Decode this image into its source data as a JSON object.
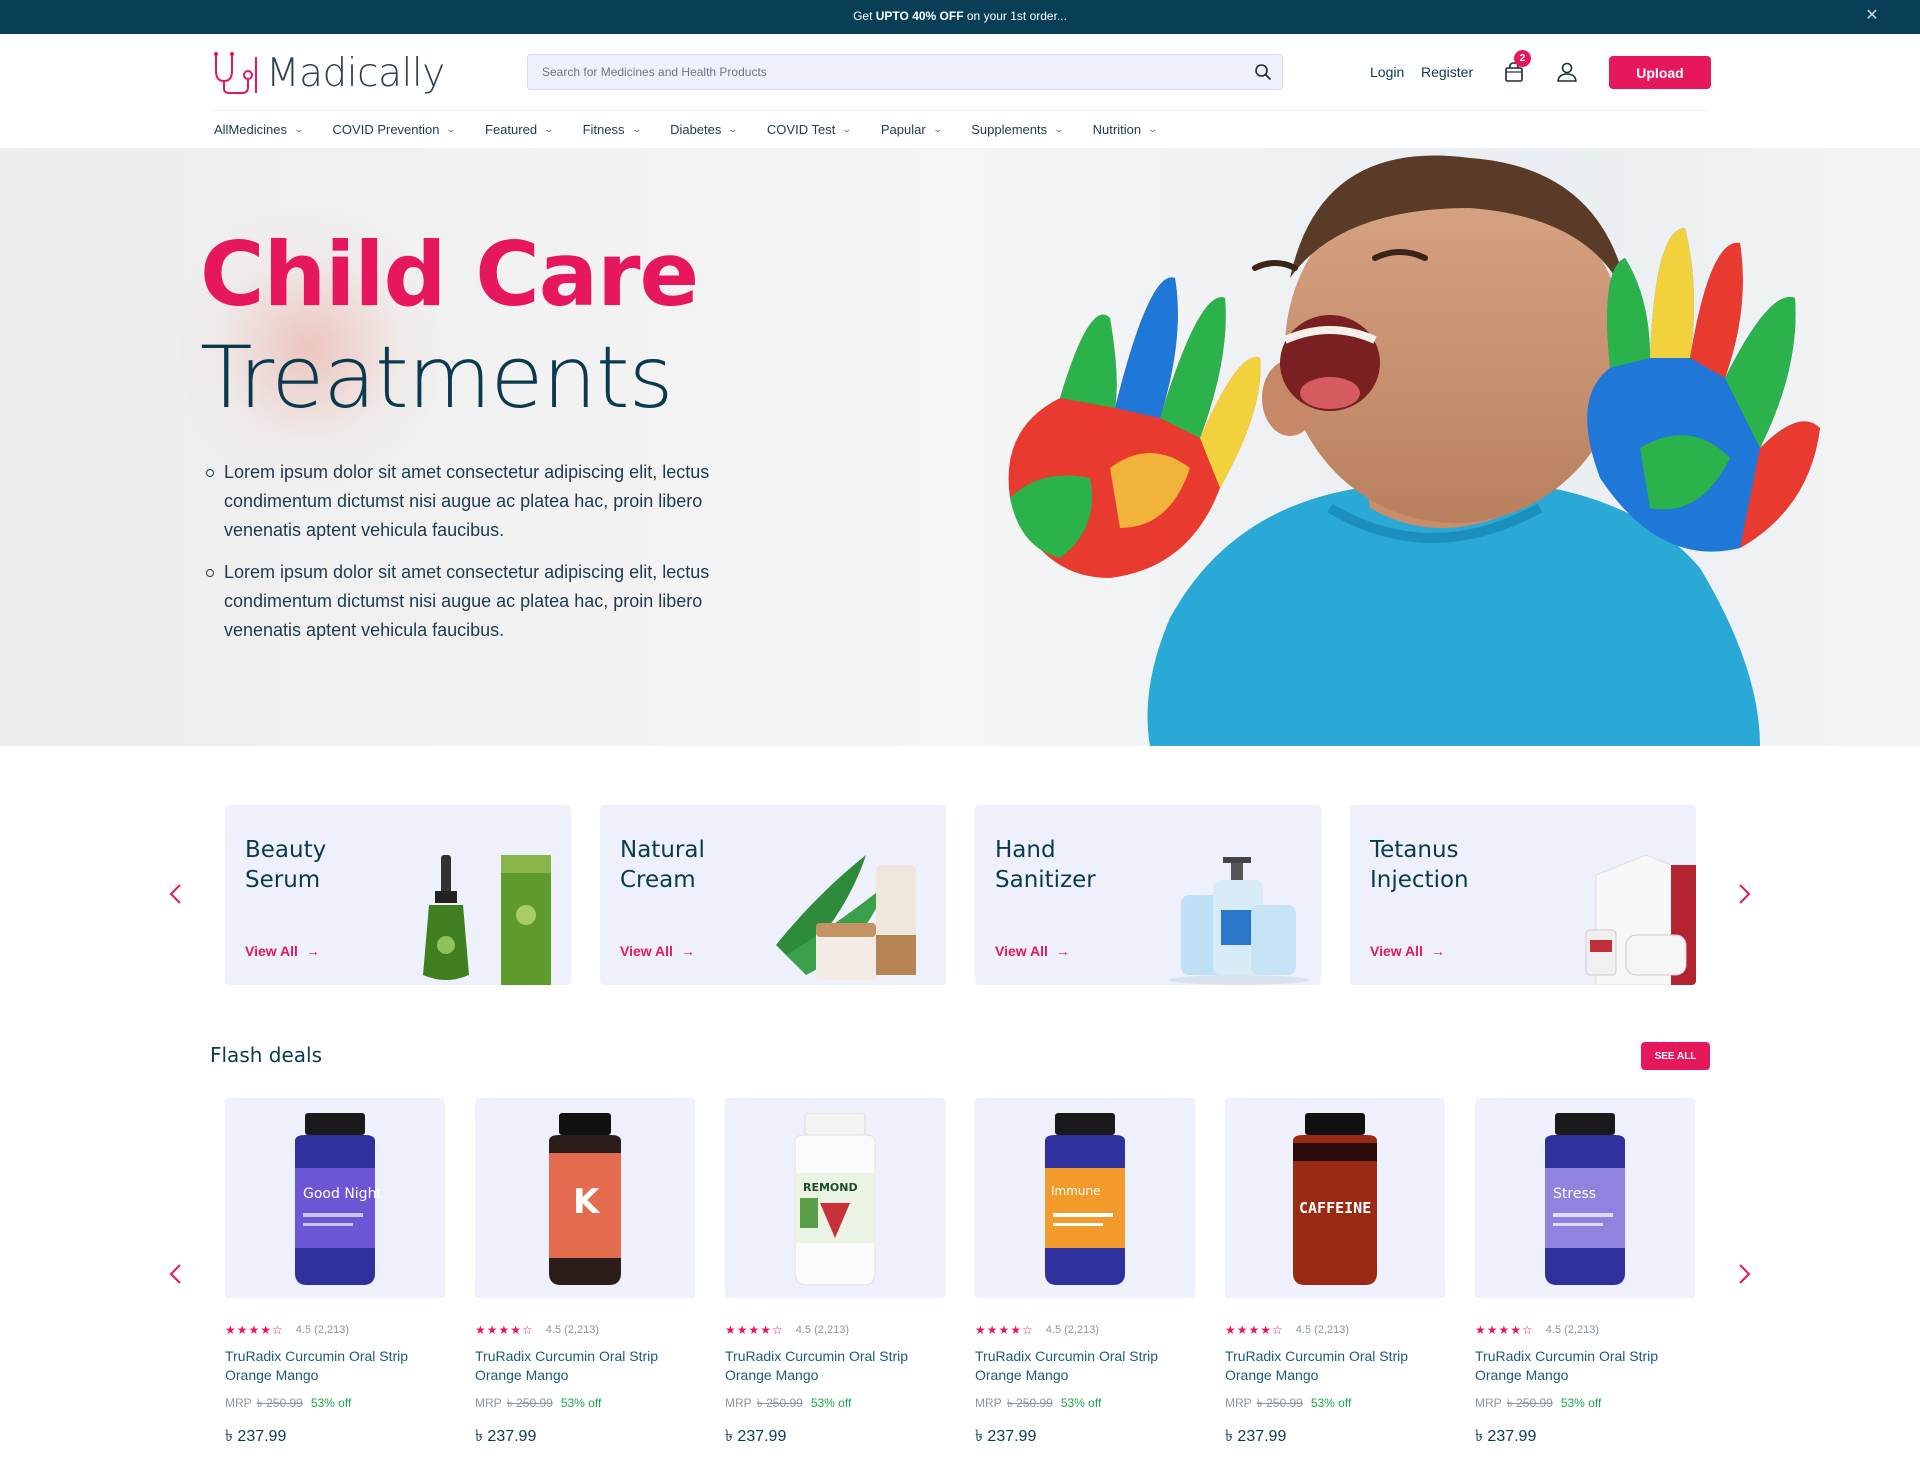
{
  "promo": {
    "prefix": "Get ",
    "highlight": "UPTO 40% OFF",
    "suffix": " on your 1st order..."
  },
  "brand": {
    "name": "Madically"
  },
  "search": {
    "placeholder": "Search for Medicines and Health Products"
  },
  "header": {
    "login": "Login",
    "register": "Register",
    "cart_count": "2",
    "upload": "Upload"
  },
  "nav": [
    {
      "label": "AllMedicines"
    },
    {
      "label": "COVID Prevention"
    },
    {
      "label": "Featured"
    },
    {
      "label": "Fitness"
    },
    {
      "label": "Diabetes"
    },
    {
      "label": "COVID Test"
    },
    {
      "label": "Papular"
    },
    {
      "label": "Supplements"
    },
    {
      "label": "Nutrition"
    }
  ],
  "hero": {
    "title_line1": "Child Care",
    "title_line2": "Treatments",
    "bullets": [
      "Lorem ipsum dolor sit amet consectetur adipiscing elit, lectus condimentum dictumst nisi augue ac platea hac, proin libero venenatis aptent vehicula faucibus.",
      "Lorem ipsum dolor sit amet consectetur adipiscing elit, lectus condimentum dictumst nisi augue ac platea hac, proin libero venenatis aptent vehicula faucibus."
    ]
  },
  "categories": [
    {
      "title": "Beauty Serum",
      "cta": "View All"
    },
    {
      "title": "Natural Cream",
      "cta": "View All"
    },
    {
      "title": "Hand Sanitizer",
      "cta": "View All"
    },
    {
      "title": "Tetanus Injection",
      "cta": "View All"
    }
  ],
  "flash": {
    "title": "Flash deals",
    "see_all": "SEE ALL",
    "products": [
      {
        "rating": "4.5 (2,213)",
        "name": "TruRadix Curcumin Oral Strip Orange Mango",
        "mrp_label": "MRP",
        "mrp": "৳ 250.99",
        "off": "53% off",
        "price": "৳ 237.99",
        "label_text": "Good Night"
      },
      {
        "rating": "4.5 (2,213)",
        "name": "TruRadix Curcumin Oral Strip Orange Mango",
        "mrp_label": "MRP",
        "mrp": "৳ 250.99",
        "off": "53% off",
        "price": "৳ 237.99",
        "label_text": "K"
      },
      {
        "rating": "4.5 (2,213)",
        "name": "TruRadix Curcumin Oral Strip Orange Mango",
        "mrp_label": "MRP",
        "mrp": "৳ 250.99",
        "off": "53% off",
        "price": "৳ 237.99",
        "label_text": "REMOND"
      },
      {
        "rating": "4.5 (2,213)",
        "name": "TruRadix Curcumin Oral Strip Orange Mango",
        "mrp_label": "MRP",
        "mrp": "৳ 250.99",
        "off": "53% off",
        "price": "৳ 237.99",
        "label_text": "Immune"
      },
      {
        "rating": "4.5 (2,213)",
        "name": "TruRadix Curcumin Oral Strip Orange Mango",
        "mrp_label": "MRP",
        "mrp": "৳ 250.99",
        "off": "53% off",
        "price": "৳ 237.99",
        "label_text": "CAFFEINE"
      },
      {
        "rating": "4.5 (2,213)",
        "name": "TruRadix Curcumin Oral Strip Orange Mango",
        "mrp_label": "MRP",
        "mrp": "৳ 250.99",
        "off": "53% off",
        "price": "৳ 237.99",
        "label_text": "Stress"
      }
    ]
  },
  "colors": {
    "accent": "#e6175c",
    "navy": "#083f57",
    "card_bg": "#eef1fb",
    "discount": "#1aa64b"
  },
  "icons": [
    "close-icon",
    "logo-stethoscope-icon",
    "search-icon",
    "cart-icon",
    "user-icon",
    "chevron-down-icon",
    "chevron-left-icon",
    "chevron-right-icon",
    "arrow-right-icon",
    "star-icon"
  ]
}
